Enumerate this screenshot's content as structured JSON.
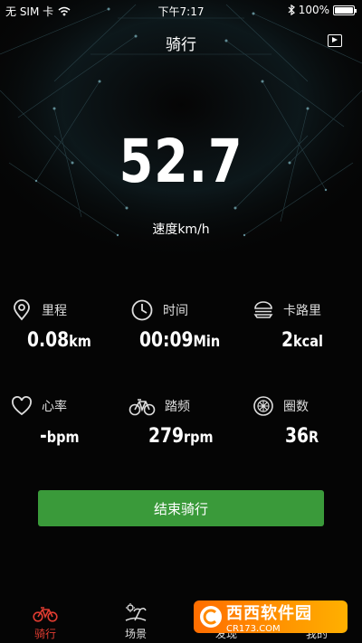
{
  "status_bar": {
    "carrier": "无 SIM 卡",
    "time": "下午7:17",
    "battery": "100%",
    "battery_level": 1.0
  },
  "header": {
    "title": "骑行"
  },
  "speed": {
    "value": "52.7",
    "label": "速度km/h"
  },
  "stats": [
    {
      "icon": "location-pin-icon",
      "label": "里程",
      "value": "0.08",
      "unit": "km"
    },
    {
      "icon": "clock-icon",
      "label": "时间",
      "value": "00:09",
      "unit": "Min"
    },
    {
      "icon": "burger-icon",
      "label": "卡路里",
      "value": "2",
      "unit": "kcal"
    },
    {
      "icon": "heart-icon",
      "label": "心率",
      "value": "-",
      "unit": "bpm"
    },
    {
      "icon": "bicycle-icon",
      "label": "踏频",
      "value": "279",
      "unit": "rpm"
    },
    {
      "icon": "wheel-icon",
      "label": "圈数",
      "value": "36",
      "unit": "R"
    }
  ],
  "actions": {
    "end_ride": "结束骑行"
  },
  "tabs": [
    {
      "icon": "bicycle-icon",
      "label": "骑行",
      "active": true
    },
    {
      "icon": "scene-icon",
      "label": "场景",
      "active": false
    },
    {
      "icon": "discover-icon",
      "label": "发现",
      "active": false
    },
    {
      "icon": "profile-icon",
      "label": "我的",
      "active": false
    }
  ],
  "watermark": {
    "logo": "西西软件园",
    "site": "CR173.COM"
  },
  "colors": {
    "accent": "#e03c31",
    "button": "#3a9a3a",
    "background": "#050505"
  }
}
